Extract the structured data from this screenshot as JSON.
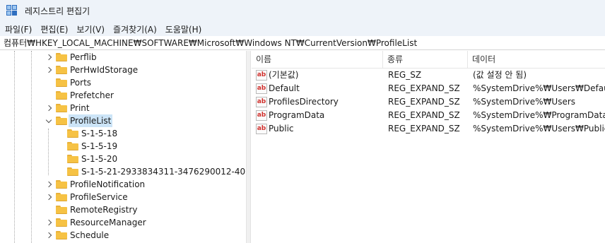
{
  "window": {
    "title": "레지스트리 편집기",
    "app_icon": "registry-editor-icon"
  },
  "menu": [
    "파일(F)",
    "편집(E)",
    "보기(V)",
    "즐겨찾기(A)",
    "도움말(H)"
  ],
  "address": "컴퓨터₩HKEY_LOCAL_MACHINE₩SOFTWARE₩Microsoft₩Windows NT₩CurrentVersion₩ProfileList",
  "tree": {
    "items": [
      {
        "label": "Perflib",
        "level": 1,
        "expander": "collapsed",
        "selected": false
      },
      {
        "label": "PerHwIdStorage",
        "level": 1,
        "expander": "collapsed",
        "selected": false
      },
      {
        "label": "Ports",
        "level": 1,
        "expander": "none",
        "selected": false
      },
      {
        "label": "Prefetcher",
        "level": 1,
        "expander": "none",
        "selected": false
      },
      {
        "label": "Print",
        "level": 1,
        "expander": "collapsed",
        "selected": false
      },
      {
        "label": "ProfileList",
        "level": 1,
        "expander": "expanded",
        "selected": true
      },
      {
        "label": "S-1-5-18",
        "level": 2,
        "expander": "none",
        "selected": false
      },
      {
        "label": "S-1-5-19",
        "level": 2,
        "expander": "none",
        "selected": false
      },
      {
        "label": "S-1-5-20",
        "level": 2,
        "expander": "none",
        "selected": false
      },
      {
        "label": "S-1-5-21-2933834311-3476290012-40",
        "level": 2,
        "expander": "none",
        "selected": false
      },
      {
        "label": "ProfileNotification",
        "level": 1,
        "expander": "collapsed",
        "selected": false
      },
      {
        "label": "ProfileService",
        "level": 1,
        "expander": "collapsed",
        "selected": false
      },
      {
        "label": "RemoteRegistry",
        "level": 1,
        "expander": "none",
        "selected": false
      },
      {
        "label": "ResourceManager",
        "level": 1,
        "expander": "collapsed",
        "selected": false
      },
      {
        "label": "Schedule",
        "level": 1,
        "expander": "collapsed",
        "selected": false
      }
    ]
  },
  "list": {
    "columns": [
      "이름",
      "종류",
      "데이터"
    ],
    "rows": [
      {
        "name": "(기본값)",
        "type": "REG_SZ",
        "data": "(값 설정 안 됨)",
        "icon": "ab"
      },
      {
        "name": "Default",
        "type": "REG_EXPAND_SZ",
        "data": "%SystemDrive%₩Users₩Default",
        "icon": "ab"
      },
      {
        "name": "ProfilesDirectory",
        "type": "REG_EXPAND_SZ",
        "data": "%SystemDrive%₩Users",
        "icon": "ab"
      },
      {
        "name": "ProgramData",
        "type": "REG_EXPAND_SZ",
        "data": "%SystemDrive%₩ProgramData",
        "icon": "ab"
      },
      {
        "name": "Public",
        "type": "REG_EXPAND_SZ",
        "data": "%SystemDrive%₩Users₩Public",
        "icon": "ab"
      }
    ]
  },
  "colors": {
    "accent": "#cce4f7",
    "folder": "#f6c244",
    "chrome": "#eef3f9"
  }
}
